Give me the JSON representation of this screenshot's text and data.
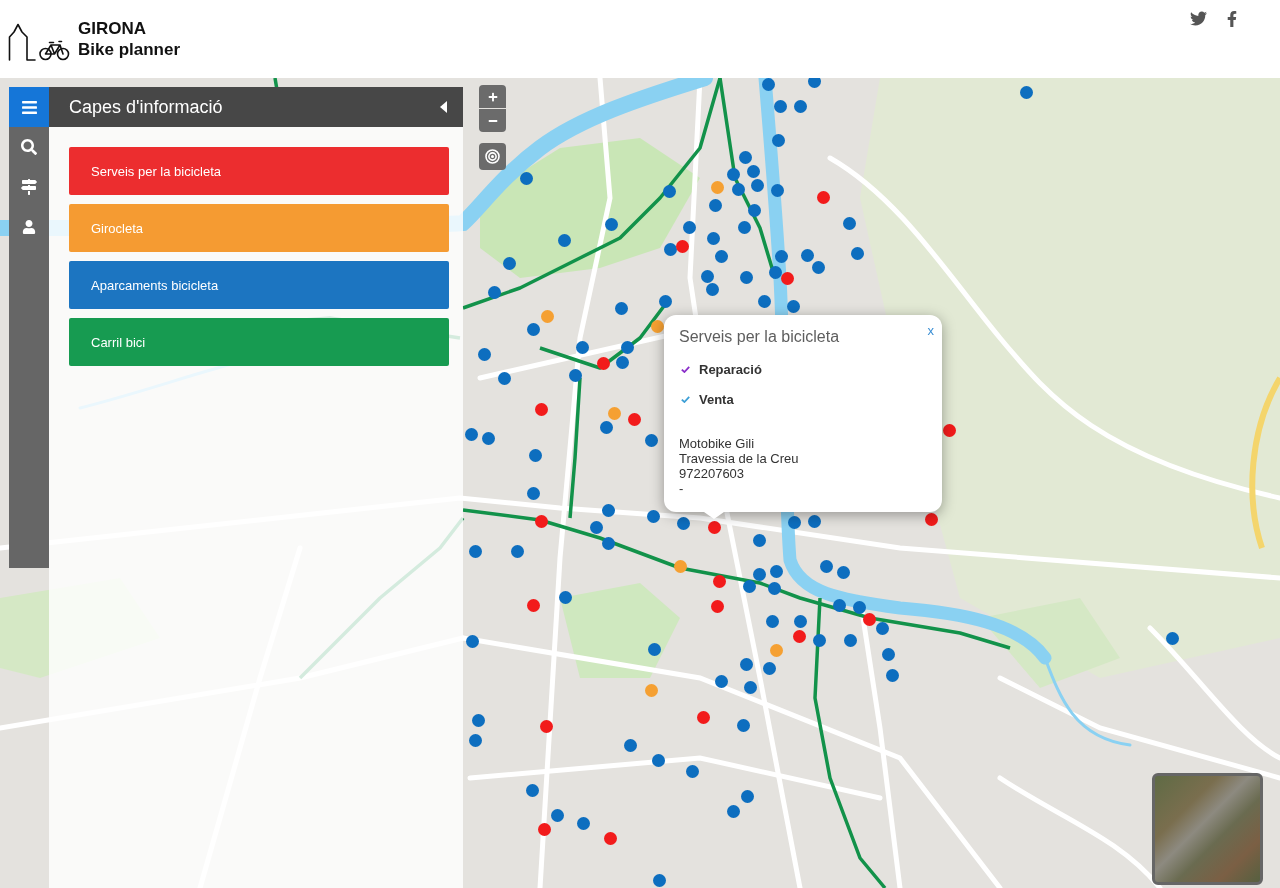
{
  "header": {
    "title": "GIRONA",
    "subtitle": "Bike planner"
  },
  "panel": {
    "open": true,
    "title": "Capes d'informació",
    "layers": [
      {
        "label": "Serveis per la bicicleta",
        "color": "#ec2d2f"
      },
      {
        "label": "Girocleta",
        "color": "#f59b32"
      },
      {
        "label": "Aparcaments bicicleta",
        "color": "#1c75c1"
      },
      {
        "label": "Carril bici",
        "color": "#179b51"
      }
    ]
  },
  "map": {
    "markers": [
      {
        "color": "#0d6ebf"
      },
      {
        "color": "#0d6ebf"
      },
      {
        "color": "#0d6ebf"
      },
      {
        "color": "#0d6ebf"
      },
      {
        "color": "#0d6ebf"
      },
      {
        "color": "#0d6ebf"
      },
      {
        "color": "#0d6ebf"
      },
      {
        "color": "#0d6ebf"
      },
      {
        "color": "#0d6ebf"
      },
      {
        "color": "#f5a032"
      },
      {
        "color": "#0d6ebf"
      },
      {
        "color": "#0d6ebf"
      },
      {
        "color": "#0d6ebf"
      },
      {
        "color": "#f21b1b"
      },
      {
        "color": "#0d6ebf"
      },
      {
        "color": "#0d6ebf"
      },
      {
        "color": "#0d6ebf"
      },
      {
        "color": "#0d6ebf"
      },
      {
        "color": "#0d6ebf"
      },
      {
        "color": "#0d6ebf"
      },
      {
        "color": "#0d6ebf"
      },
      {
        "color": "#0d6ebf"
      },
      {
        "color": "#0d6ebf"
      },
      {
        "color": "#0d6ebf"
      },
      {
        "color": "#f21b1b"
      },
      {
        "color": "#0d6ebf"
      },
      {
        "color": "#0d6ebf"
      },
      {
        "color": "#0d6ebf"
      },
      {
        "color": "#0d6ebf"
      },
      {
        "color": "#0d6ebf"
      },
      {
        "color": "#0d6ebf"
      },
      {
        "color": "#0d6ebf"
      },
      {
        "color": "#f21b1b"
      },
      {
        "color": "#0d6ebf"
      },
      {
        "color": "#0d6ebf"
      },
      {
        "color": "#0d6ebf"
      },
      {
        "color": "#0d6ebf"
      },
      {
        "color": "#0d6ebf"
      },
      {
        "color": "#0d6ebf"
      },
      {
        "color": "#0d6ebf"
      },
      {
        "color": "#0d6ebf"
      },
      {
        "color": "#0d6ebf"
      },
      {
        "color": "#f5a032"
      },
      {
        "color": "#0d6ebf"
      },
      {
        "color": "#f5a032"
      },
      {
        "color": "#0d6ebf"
      },
      {
        "color": "#0d6ebf"
      },
      {
        "color": "#0d6ebf"
      },
      {
        "color": "#f21b1b"
      },
      {
        "color": "#0d6ebf"
      },
      {
        "color": "#0d6ebf"
      },
      {
        "color": "#0d6ebf"
      },
      {
        "color": "#f21b1b"
      },
      {
        "color": "#f5a032"
      },
      {
        "color": "#f21b1b"
      },
      {
        "color": "#0d6ebf"
      },
      {
        "color": "#0d6ebf"
      },
      {
        "color": "#0d6ebf"
      },
      {
        "color": "#0d6ebf"
      },
      {
        "color": "#f21b1b"
      },
      {
        "color": "#0d6ebf"
      },
      {
        "color": "#0d6ebf"
      },
      {
        "color": "#0d6ebf"
      },
      {
        "color": "#f21b1b"
      },
      {
        "color": "#0d6ebf"
      },
      {
        "color": "#0d6ebf"
      },
      {
        "color": "#0d6ebf"
      },
      {
        "color": "#f21b1b"
      },
      {
        "color": "#0d6ebf"
      },
      {
        "color": "#0d6ebf"
      },
      {
        "color": "#f21b1b"
      },
      {
        "color": "#0d6ebf"
      },
      {
        "color": "#0d6ebf"
      },
      {
        "color": "#0d6ebf"
      },
      {
        "color": "#0d6ebf"
      },
      {
        "color": "#f5a032"
      },
      {
        "color": "#0d6ebf"
      },
      {
        "color": "#0d6ebf"
      },
      {
        "color": "#f21b1b"
      },
      {
        "color": "#0d6ebf"
      },
      {
        "color": "#0d6ebf"
      },
      {
        "color": "#0d6ebf"
      },
      {
        "color": "#0d6ebf"
      },
      {
        "color": "#0d6ebf"
      },
      {
        "color": "#f21b1b"
      },
      {
        "color": "#f21b1b"
      },
      {
        "color": "#0d6ebf"
      },
      {
        "color": "#0d6ebf"
      },
      {
        "color": "#f21b1b"
      },
      {
        "color": "#0d6ebf"
      },
      {
        "color": "#0d6ebf"
      },
      {
        "color": "#0d6ebf"
      },
      {
        "color": "#f21b1b"
      },
      {
        "color": "#0d6ebf"
      },
      {
        "color": "#0d6ebf"
      },
      {
        "color": "#0d6ebf"
      },
      {
        "color": "#0d6ebf"
      },
      {
        "color": "#0d6ebf"
      },
      {
        "color": "#0d6ebf"
      },
      {
        "color": "#f5a032"
      },
      {
        "color": "#0d6ebf"
      },
      {
        "color": "#0d6ebf"
      },
      {
        "color": "#0d6ebf"
      },
      {
        "color": "#0d6ebf"
      },
      {
        "color": "#0d6ebf"
      },
      {
        "color": "#f5a032"
      },
      {
        "color": "#f21b1b"
      },
      {
        "color": "#0d6ebf"
      },
      {
        "color": "#f21b1b"
      },
      {
        "color": "#0d6ebf"
      },
      {
        "color": "#0d6ebf"
      },
      {
        "color": "#0d6ebf"
      },
      {
        "color": "#0d6ebf"
      },
      {
        "color": "#0d6ebf"
      },
      {
        "color": "#0d6ebf"
      },
      {
        "color": "#0d6ebf"
      },
      {
        "color": "#0d6ebf"
      },
      {
        "color": "#0d6ebf"
      },
      {
        "color": "#f21b1b"
      },
      {
        "color": "#0d6ebf"
      },
      {
        "color": "#f21b1b"
      },
      {
        "color": "#0d6ebf"
      }
    ]
  },
  "popup": {
    "title": "Serveis per la bicicleta",
    "close": "x",
    "services": [
      {
        "label": "Reparació",
        "color": "#8a2ec9"
      },
      {
        "label": "Venta",
        "color": "#3d9fd6"
      }
    ],
    "details": [
      "Motobike Gili",
      "Travessia de la Creu",
      "972207603",
      "-"
    ]
  }
}
